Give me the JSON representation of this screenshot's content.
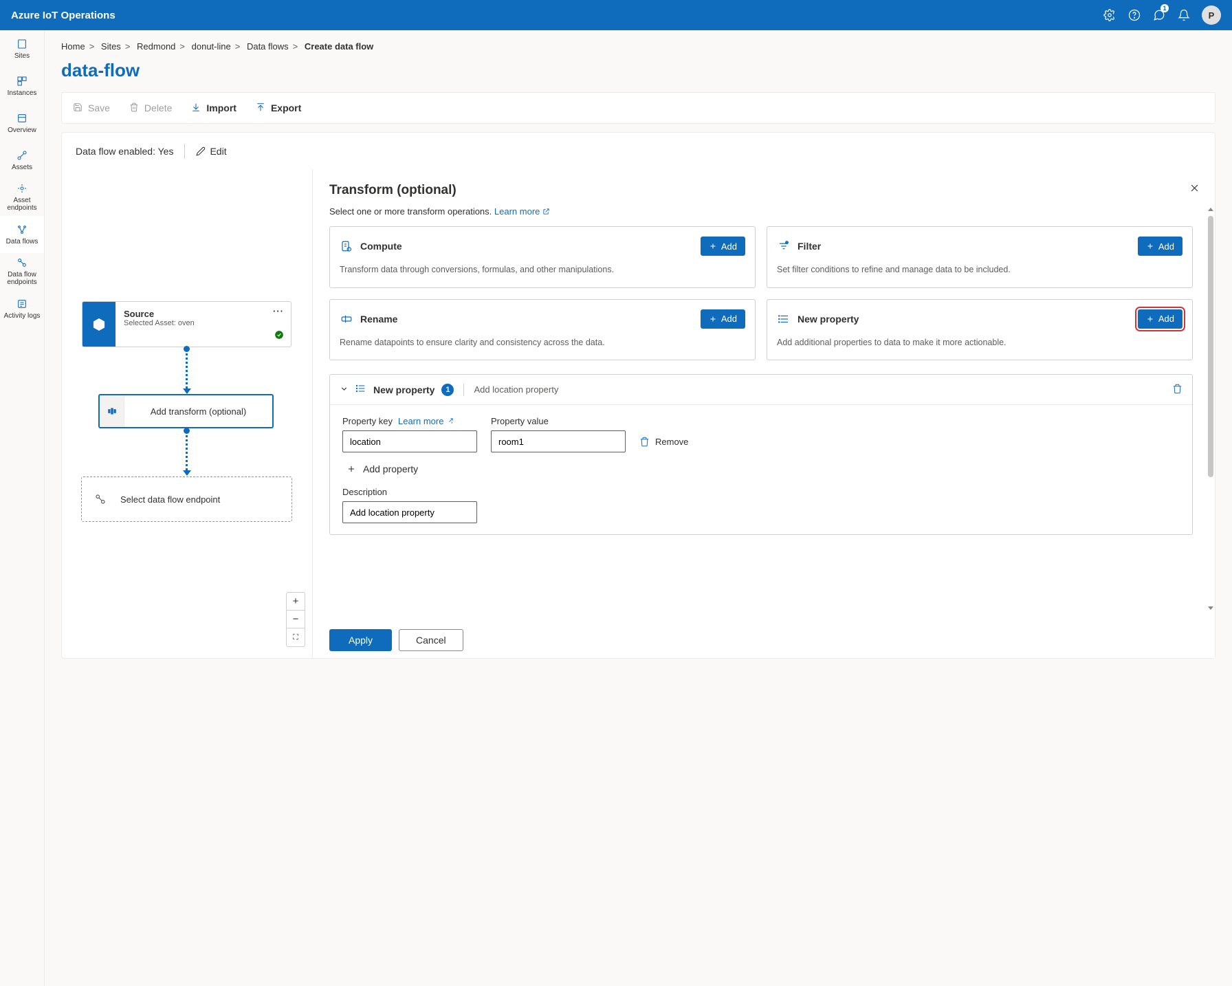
{
  "header": {
    "brand": "Azure IoT Operations",
    "notification_count": "1",
    "avatar_initial": "P"
  },
  "sidebar": {
    "items": [
      {
        "label": "Sites"
      },
      {
        "label": "Instances"
      },
      {
        "label": "Overview"
      },
      {
        "label": "Assets"
      },
      {
        "label": "Asset endpoints"
      },
      {
        "label": "Data flows"
      },
      {
        "label": "Data flow endpoints"
      },
      {
        "label": "Activity logs"
      }
    ]
  },
  "breadcrumb": {
    "items": [
      "Home",
      "Sites",
      "Redmond",
      "donut-line",
      "Data flows"
    ],
    "current": "Create data flow"
  },
  "page": {
    "title": "data-flow"
  },
  "toolbar": {
    "save": "Save",
    "delete": "Delete",
    "import": "Import",
    "export": "Export"
  },
  "status": {
    "label": "Data flow enabled:",
    "value": "Yes",
    "edit": "Edit"
  },
  "canvas": {
    "source": {
      "title": "Source",
      "subtitle": "Selected Asset: oven"
    },
    "transform": {
      "label": "Add transform (optional)"
    },
    "endpoint": {
      "label": "Select data flow endpoint"
    }
  },
  "panel": {
    "title": "Transform (optional)",
    "description": "Select one or more transform operations.",
    "learn_more": "Learn more",
    "add": "Add",
    "cards": {
      "compute": {
        "title": "Compute",
        "desc": "Transform data through conversions, formulas, and other manipulations."
      },
      "filter": {
        "title": "Filter",
        "desc": "Set filter conditions to refine and manage data to be included."
      },
      "rename": {
        "title": "Rename",
        "desc": "Rename datapoints to ensure clarity and consistency across the data."
      },
      "new_property": {
        "title": "New property",
        "desc": "Add additional properties to data to make it more actionable."
      }
    },
    "section": {
      "title": "New property",
      "count": "1",
      "subtitle": "Add location property",
      "prop_key_label": "Property key",
      "prop_value_label": "Property value",
      "prop_key": "location",
      "prop_value": "room1",
      "remove": "Remove",
      "add_property": "Add property",
      "description_label": "Description",
      "description_value": "Add location property"
    },
    "apply": "Apply",
    "cancel": "Cancel"
  }
}
